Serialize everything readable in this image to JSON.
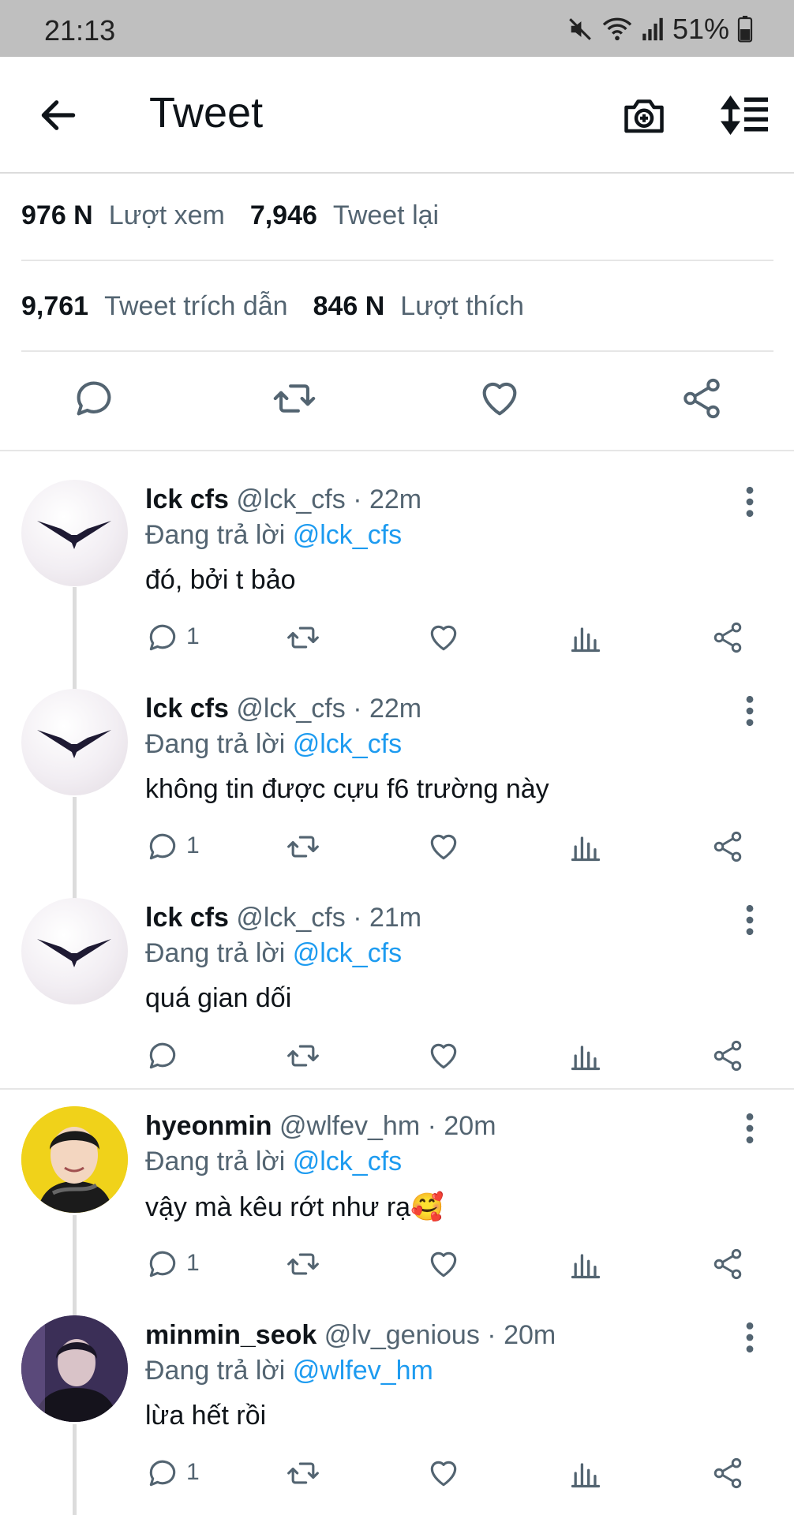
{
  "status_bar": {
    "time": "21:13",
    "battery": "51%",
    "icons": [
      "mute-icon",
      "wifi-icon",
      "signal-icon",
      "battery-icon"
    ]
  },
  "header": {
    "title": "Tweet",
    "back_icon": "arrow-left-icon",
    "camera_icon": "camera-plus-icon",
    "sort_icon": "sort-icon"
  },
  "stats": {
    "views_count": "976 N",
    "views_label": "Lượt xem",
    "retweets_count": "7,946",
    "retweets_label": "Tweet lại",
    "quotes_count": "9,761",
    "quotes_label": "Tweet trích dẫn",
    "likes_count": "846 N",
    "likes_label": "Lượt thích"
  },
  "replies": [
    {
      "name": "lck cfs",
      "handle": "@lck_cfs",
      "time": "22m",
      "replying_prefix": "Đang trả lời",
      "replying_to": "@lck_cfs",
      "text": "đó, bởi t bảo",
      "reply_count": "1"
    },
    {
      "name": "lck cfs",
      "handle": "@lck_cfs",
      "time": "22m",
      "replying_prefix": "Đang trả lời",
      "replying_to": "@lck_cfs",
      "text": "không tin được cựu f6 trường này",
      "reply_count": "1"
    },
    {
      "name": "lck cfs",
      "handle": "@lck_cfs",
      "time": "21m",
      "replying_prefix": "Đang trả lời",
      "replying_to": "@lck_cfs",
      "text": "quá gian dối",
      "reply_count": ""
    },
    {
      "name": "hyeonmin",
      "handle": "@wlfev_hm",
      "time": "20m",
      "replying_prefix": "Đang trả lời",
      "replying_to": "@lck_cfs",
      "text": "vậy mà kêu rớt như rạ🥰",
      "reply_count": "1"
    },
    {
      "name": "minmin_seok",
      "handle": "@lv_genious",
      "time": "20m",
      "replying_prefix": "Đang trả lời",
      "replying_to": "@wlfev_hm",
      "text": "lừa hết rồi",
      "reply_count": "1"
    }
  ],
  "colors": {
    "link": "#1d9bf0",
    "secondary_text": "#536471",
    "status_bar_bg": "#bfbfbf"
  }
}
